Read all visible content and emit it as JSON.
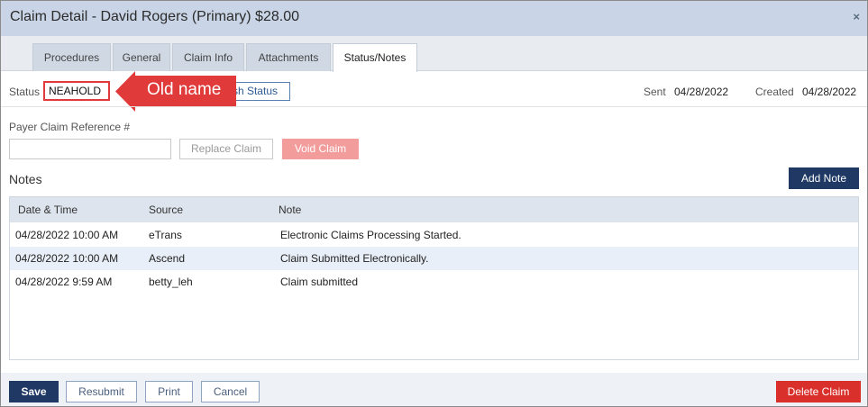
{
  "window": {
    "title": "Claim Detail - David Rogers (Primary) $28.00",
    "close_glyph": "×"
  },
  "tabs": [
    {
      "label": "Procedures",
      "active": false
    },
    {
      "label": "General",
      "active": false
    },
    {
      "label": "Claim Info",
      "active": false
    },
    {
      "label": "Attachments",
      "active": false
    },
    {
      "label": "Status/Notes",
      "active": true
    }
  ],
  "status": {
    "label": "Status",
    "value": "NEAHOLD",
    "refresh_button": "ish Status",
    "annotation": "Old name"
  },
  "dates": {
    "sent_label": "Sent",
    "sent_value": "04/28/2022",
    "created_label": "Created",
    "created_value": "04/28/2022"
  },
  "payer_ref": {
    "label": "Payer Claim Reference #",
    "value": "",
    "placeholder": ""
  },
  "buttons": {
    "replace": "Replace Claim",
    "void": "Void Claim",
    "add_note": "Add Note",
    "save": "Save",
    "resubmit": "Resubmit",
    "print": "Print",
    "cancel": "Cancel",
    "delete": "Delete Claim"
  },
  "notes": {
    "title": "Notes",
    "columns": [
      "Date & Time",
      "Source",
      "Note"
    ],
    "rows": [
      {
        "datetime": "04/28/2022 10:00 AM",
        "source": "eTrans",
        "note": "Electronic Claims Processing Started."
      },
      {
        "datetime": "04/28/2022 10:00 AM",
        "source": "Ascend",
        "note": "Claim Submitted Electronically."
      },
      {
        "datetime": "04/28/2022 9:59 AM",
        "source": "betty_leh",
        "note": "Claim submitted"
      }
    ]
  },
  "colors": {
    "annotation_red": "#e03a3a",
    "primary_navy": "#1f3864",
    "delete_red": "#d9302c",
    "void_pink": "#f39c9c",
    "title_bar": "#c9d5e6"
  }
}
